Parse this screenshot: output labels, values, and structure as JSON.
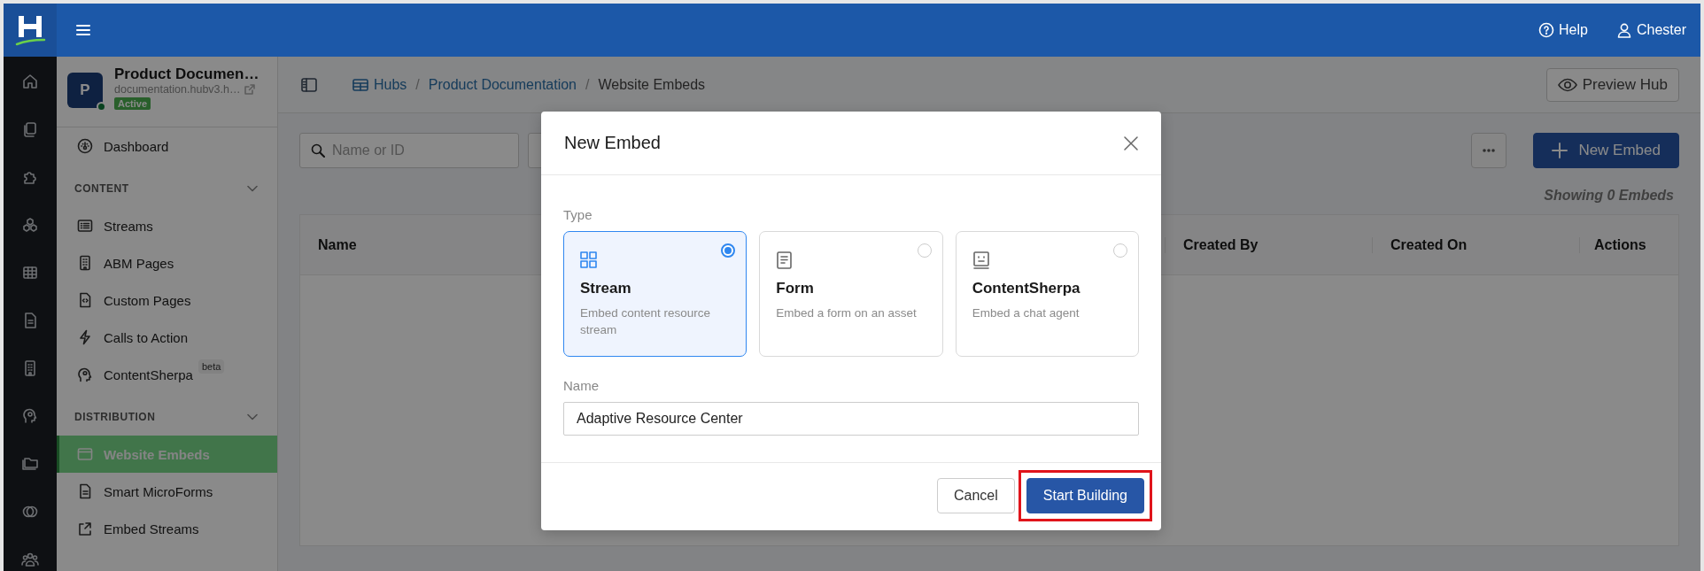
{
  "top_bar": {
    "help": "Help",
    "user": "Chester"
  },
  "hub": {
    "avatar_letter": "P",
    "title": "Product Documen…",
    "url": "documentation.hubv3.h…",
    "status": "Active"
  },
  "sidebar": {
    "items": [
      {
        "kind": "link",
        "label": "Dashboard",
        "selected": false
      },
      {
        "kind": "section",
        "label": "CONTENT",
        "expanded": true
      },
      {
        "kind": "link",
        "label": "Streams",
        "selected": false
      },
      {
        "kind": "link",
        "label": "ABM Pages",
        "selected": false
      },
      {
        "kind": "link",
        "label": "Custom Pages",
        "selected": false
      },
      {
        "kind": "link",
        "label": "Calls to Action",
        "selected": false
      },
      {
        "kind": "link",
        "label": "ContentSherpa",
        "badge": "beta",
        "selected": false
      },
      {
        "kind": "section",
        "label": "DISTRIBUTION",
        "expanded": true
      },
      {
        "kind": "link",
        "label": "Website Embeds",
        "selected": true
      },
      {
        "kind": "link",
        "label": "Smart MicroForms",
        "selected": false
      },
      {
        "kind": "link",
        "label": "Embed Streams",
        "selected": false
      }
    ]
  },
  "breadcrumb_separator": "/",
  "breadcrumb": [
    {
      "label": "Hubs",
      "selected": false
    },
    {
      "label": "Product Documentation",
      "selected": false
    },
    {
      "label": "Website Embeds",
      "selected": true
    }
  ],
  "preview_button": "Preview Hub",
  "search": {
    "placeholder": "Name or ID"
  },
  "new_button": "New Embed",
  "count": "Showing 0 Embeds",
  "table": {
    "columns": [
      "Name",
      "Created By",
      "Created On",
      "Actions"
    ]
  },
  "modal": {
    "title": "New Embed",
    "type_label": "Type",
    "types": [
      {
        "kind": "stream",
        "title": "Stream",
        "description": "Embed content resource stream",
        "selected": true
      },
      {
        "kind": "form",
        "title": "Form",
        "description": "Embed a form on an asset",
        "selected": false
      },
      {
        "kind": "chat",
        "title": "ContentSherpa",
        "description": "Embed a chat agent",
        "selected": false
      }
    ],
    "name_label": "Name",
    "name_value": "Adaptive Resource Center",
    "buttons": [
      {
        "label": "Cancel",
        "kind": "secondary",
        "highlighted": false
      },
      {
        "label": "Start Building",
        "kind": "primary",
        "highlighted": true
      }
    ]
  }
}
